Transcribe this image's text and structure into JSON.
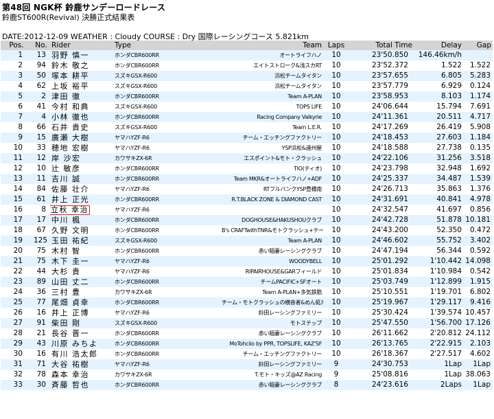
{
  "header": {
    "title": "第48回 NGK杯 鈴鹿サンデーロードレース",
    "subtitle": "鈴鹿ST600R(Revival) 決勝正式結果表",
    "info": "DATE:2012-12-09 WEATHER : Cloudy COURSE : Dry 国際レーシングコース 5.821km"
  },
  "table": {
    "columns": [
      "Pos.",
      "No.",
      "Rider",
      "Type",
      "Team",
      "Laps",
      "Total Time",
      "Delay",
      "Gap"
    ],
    "highlight_color": "#e02020",
    "stripe_color": "#e4f3ff",
    "header_color": "#d4d4d4",
    "rows": [
      {
        "pos": "1",
        "no": "13",
        "rider": "羽野 慎一",
        "type": "ホンダCBR600RR",
        "team": "オートライフハノ",
        "laps": "10",
        "total": "23'50.850",
        "delay": "146.46km/h",
        "gap": ""
      },
      {
        "pos": "2",
        "no": "94",
        "rider": "鈴木 敬之",
        "type": "ホンダCBR600RR",
        "team": "エイトストローク&浅スカRT",
        "laps": "10",
        "total": "23'52.372",
        "delay": "1.522",
        "gap": "1.522"
      },
      {
        "pos": "3",
        "no": "50",
        "rider": "塚本 耕平",
        "type": "スズキGSX-R600",
        "team": "浜松チームタイタン",
        "laps": "10",
        "total": "23'57.655",
        "delay": "6.805",
        "gap": "5.283"
      },
      {
        "pos": "4",
        "no": "62",
        "rider": "上坂 裕平",
        "type": "スズキGSX-R600",
        "team": "浜松チームタイタン",
        "laps": "10",
        "total": "23'57.779",
        "delay": "6.929",
        "gap": "0.124"
      },
      {
        "pos": "5",
        "no": "2",
        "rider": "津田 徹",
        "type": "ホンダCBR600RR",
        "team": "Team A-PLAN",
        "laps": "10",
        "total": "23'58.953",
        "delay": "8.103",
        "gap": "1.174"
      },
      {
        "pos": "6",
        "no": "41",
        "rider": "今村 和典",
        "type": "スズキGSX-R600",
        "team": "TOPS LIFE",
        "laps": "10",
        "total": "24'06.644",
        "delay": "15.794",
        "gap": "7.691"
      },
      {
        "pos": "7",
        "no": "4",
        "rider": "小林 徹也",
        "type": "ホンダCBR600RR",
        "team": "Racing Company Valkyrie",
        "laps": "10",
        "total": "24'11.361",
        "delay": "20.511",
        "gap": "4.717"
      },
      {
        "pos": "8",
        "no": "66",
        "rider": "石井 貴史",
        "type": "スズキGSX-R600",
        "team": "Team L.E.R.",
        "laps": "10",
        "total": "24'17.269",
        "delay": "26.419",
        "gap": "5.908"
      },
      {
        "pos": "9",
        "no": "15",
        "rider": "廣瀬 大樹",
        "type": "ヤマハYZF-R6",
        "team": "チーム・エッチングファクトリー",
        "laps": "10",
        "total": "24'18.453",
        "delay": "27.603",
        "gap": "1.184"
      },
      {
        "pos": "10",
        "no": "33",
        "rider": "穂地 宏樹",
        "type": "ヤマハYZF-R6",
        "team": "YSP浜松&遠州屋",
        "laps": "10",
        "total": "24'18.588",
        "delay": "27.738",
        "gap": "0.135"
      },
      {
        "pos": "11",
        "no": "12",
        "rider": "岸 沙宏",
        "type": "カワサキZX-6R",
        "team": "エスポイント&モト・クラッシュ",
        "laps": "10",
        "total": "24'22.106",
        "delay": "31.256",
        "gap": "3.518"
      },
      {
        "pos": "12",
        "no": "10",
        "rider": "辻 敏彦",
        "type": "ホンダCBR600RR",
        "team": "TIO(ティオ)",
        "laps": "10",
        "total": "24'23.798",
        "delay": "32.948",
        "gap": "1.692"
      },
      {
        "pos": "13",
        "no": "11",
        "rider": "吉川 誠",
        "type": "ホンダCBR600RR",
        "team": "Team MKR&オートライフハノ+ADF",
        "laps": "10",
        "total": "24'25.337",
        "delay": "34.487",
        "gap": "1.539"
      },
      {
        "pos": "14",
        "no": "84",
        "rider": "佐藤 壮介",
        "type": "ヤマハYZF-R6",
        "team": "RTフルバンクYSP豊橋南",
        "laps": "10",
        "total": "24'26.713",
        "delay": "35.863",
        "gap": "1.376"
      },
      {
        "pos": "15",
        "no": "61",
        "rider": "井上 正光",
        "type": "ホンダCBR600RR",
        "team": "R.T.BLACK ZONE & DIAMOND CAST",
        "laps": "10",
        "total": "24'31.691",
        "delay": "40.841",
        "gap": "4.978"
      },
      {
        "pos": "16",
        "no": "8",
        "rider": "立秋 幸治",
        "type": "ヤマハYZF-R6",
        "team": "",
        "laps": "10",
        "total": "24'32.547",
        "delay": "41.697",
        "gap": "0.856",
        "highlight": true
      },
      {
        "pos": "17",
        "no": "17",
        "rider": "中川 楓",
        "type": "ホンダCBR600RR",
        "team": "DOGHOUSE&HAKUSHOUクラブ",
        "laps": "10",
        "total": "24'42.728",
        "delay": "51.878",
        "gap": "10.181"
      },
      {
        "pos": "18",
        "no": "67",
        "rider": "久野 文明",
        "type": "ホンダCBR600RR",
        "team": "B's CRAFTwithTNR&モトクラッシュ+テーラデザイン",
        "laps": "10",
        "total": "24'43.200",
        "delay": "52.350",
        "gap": "0.472"
      },
      {
        "pos": "19",
        "no": "125",
        "rider": "玉田 祐紀",
        "type": "スズキGSX-R600",
        "team": "Team A-PLAN",
        "laps": "10",
        "total": "24'46.602",
        "delay": "55.752",
        "gap": "3.402"
      },
      {
        "pos": "20",
        "no": "75",
        "rider": "木村 智",
        "type": "ホンダCBR600RR",
        "team": "赤い稲妻レーシングクラブ",
        "laps": "10",
        "total": "24'47.194",
        "delay": "56.344",
        "gap": "0.592"
      },
      {
        "pos": "21",
        "no": "75",
        "rider": "木下 圭一",
        "type": "ヤマハYZF-R6",
        "team": "WOODYBELL",
        "laps": "10",
        "total": "25'01.292",
        "delay": "1'10.442",
        "gap": "14.098"
      },
      {
        "pos": "22",
        "no": "44",
        "rider": "大杉 貴",
        "type": "ヤマハYZF-R6",
        "team": "RIPAIRHOUSE&GARフィールド",
        "laps": "10",
        "total": "25'01.834",
        "delay": "1'10.984",
        "gap": "0.542"
      },
      {
        "pos": "23",
        "no": "89",
        "rider": "山田 丈二",
        "type": "ホンダCBR600RR",
        "team": "チームPACIFIC+SFオート",
        "laps": "10",
        "total": "25'03.749",
        "delay": "1'12.899",
        "gap": "1.915"
      },
      {
        "pos": "24",
        "no": "36",
        "rider": "三村 豊",
        "type": "カワサキZX-6R",
        "team": "Team A-PLAN+多気鉄筋",
        "laps": "10",
        "total": "25'10.551",
        "delay": "1'19.701",
        "gap": "6.802"
      },
      {
        "pos": "25",
        "no": "77",
        "rider": "尾畑 貞幸",
        "type": "ホンダCBR600RR",
        "team": "チーム・モトクラッシュの横音者&めん処末広",
        "laps": "10",
        "total": "25'19.967",
        "delay": "1'29.117",
        "gap": "9.416"
      },
      {
        "pos": "26",
        "no": "16",
        "rider": "井上 正博",
        "type": "ヤマハYZF-R6",
        "team": "鈴田レーシングファミリー",
        "laps": "10",
        "total": "25'30.424",
        "delay": "1'39.574",
        "gap": "10.457"
      },
      {
        "pos": "27",
        "no": "91",
        "rider": "柴田 剛",
        "type": "スズキGSX-R600",
        "team": "モトステップ",
        "laps": "10",
        "total": "25'47.550",
        "delay": "1'56.700",
        "gap": "17.126"
      },
      {
        "pos": "28",
        "no": "21",
        "rider": "長谷 晋一",
        "type": "ホンダCBR600RR",
        "team": "赤い稲妻レーシングクラブ",
        "laps": "10",
        "total": "26'11.662",
        "delay": "2'20.812",
        "gap": "24.112"
      },
      {
        "pos": "29",
        "no": "43",
        "rider": "川原 みちよ",
        "type": "ホンダCBR600RR",
        "team": "MoTohclio by PPR, TOPSLIFE, KAZ'SF",
        "laps": "10",
        "total": "26'13.765",
        "delay": "2'22.915",
        "gap": "2.103"
      },
      {
        "pos": "30",
        "no": "16",
        "rider": "有川 浩太郎",
        "type": "ホンダCBR600RR",
        "team": "チーム・エッチングファクトリー",
        "laps": "10",
        "total": "26'18.367",
        "delay": "2'27.517",
        "gap": "4.602"
      },
      {
        "pos": "31",
        "no": "71",
        "rider": "大谷 祐樹",
        "type": "ヤマハYZF-R6",
        "team": "鈴田レーシングファミリー",
        "laps": "9",
        "total": "24'30.753",
        "delay": "1Lap",
        "gap": "1Lap"
      },
      {
        "pos": "32",
        "no": "78",
        "rider": "森本 幸治",
        "type": "カワサキZX-6R",
        "team": "T.モト・キッズ@AZ Racing",
        "laps": "9",
        "total": "25'08.816",
        "delay": "1Lap",
        "gap": "38.063"
      },
      {
        "pos": "33",
        "no": "30",
        "rider": "斉藤 哲也",
        "type": "ホンダCBR600RR",
        "team": "赤い稲妻レーシングクラブ",
        "laps": "8",
        "total": "24'23.616",
        "delay": "2Laps",
        "gap": "1Lap"
      }
    ]
  }
}
